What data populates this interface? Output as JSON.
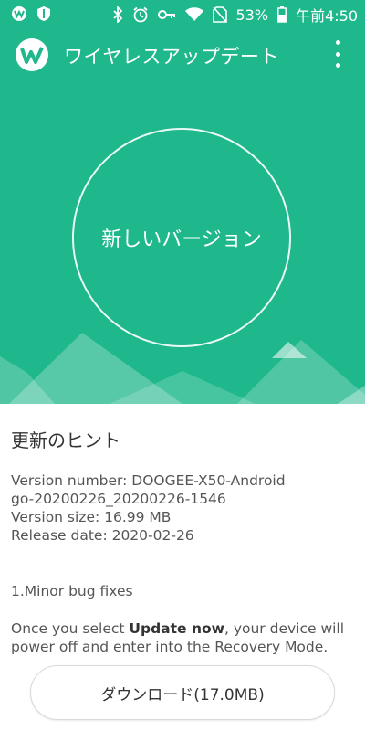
{
  "status_bar": {
    "battery": "53%",
    "time": "午前4:50",
    "icons": [
      "app-logo-icon",
      "shield-icon",
      "bluetooth-icon",
      "alarm-icon",
      "key-icon",
      "wifi-icon",
      "no-sim-icon",
      "battery-icon"
    ]
  },
  "app_bar": {
    "title": "ワイヤレスアップデート",
    "menu_icon": "more-vert-icon"
  },
  "hero": {
    "status_text": "新しいバージョン"
  },
  "update_info": {
    "section_title": "更新のヒント",
    "version_number_line1": "Version number: DOOGEE-X50-Android",
    "version_number_line2": "go-20200226_20200226-1546",
    "version_size": "Version size: 16.99 MB",
    "release_date": "Release date: 2020-02-26",
    "changes": "1.Minor bug fixes",
    "note_prefix": "Once you select ",
    "note_bold": "Update now",
    "note_suffix": ", your device will power off and enter into the Recovery Mode."
  },
  "download_button": {
    "label": "ダウンロード(17.0MB)"
  },
  "colors": {
    "primary": "#1fb78c",
    "text": "#555555"
  }
}
